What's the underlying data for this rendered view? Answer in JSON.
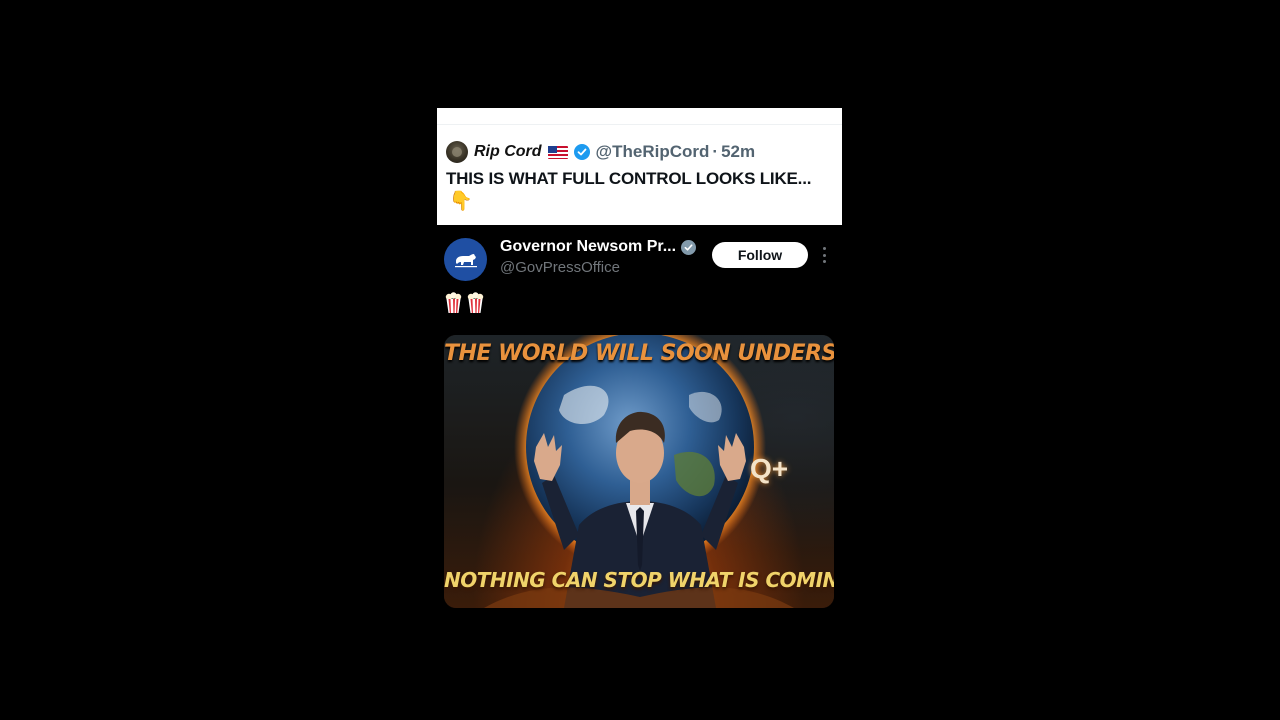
{
  "quote_tweet": {
    "name": "Rip Cord",
    "handle": "@TheRipCord",
    "separator": "·",
    "time": "52m",
    "text": "THIS IS WHAT FULL CONTROL LOOKS LIKE...",
    "emoji": "👇"
  },
  "tweet": {
    "name": "Governor Newsom Pr...",
    "handle": "@GovPressOffice",
    "follow_label": "Follow",
    "text_icons": [
      "popcorn-icon",
      "popcorn-icon"
    ],
    "image": {
      "caption_top": "THE WORLD WILL SOON UNDERSTAND",
      "caption_bottom": "NOTHING CAN STOP WHAT IS COMING",
      "overlay_text": "Q+"
    }
  },
  "colors": {
    "background": "#000000",
    "verified_blue": "#1d9bf0",
    "gov_avatar": "#1f4fa3",
    "caption_top": "#e9923d",
    "caption_bottom": "#f0d36a"
  }
}
